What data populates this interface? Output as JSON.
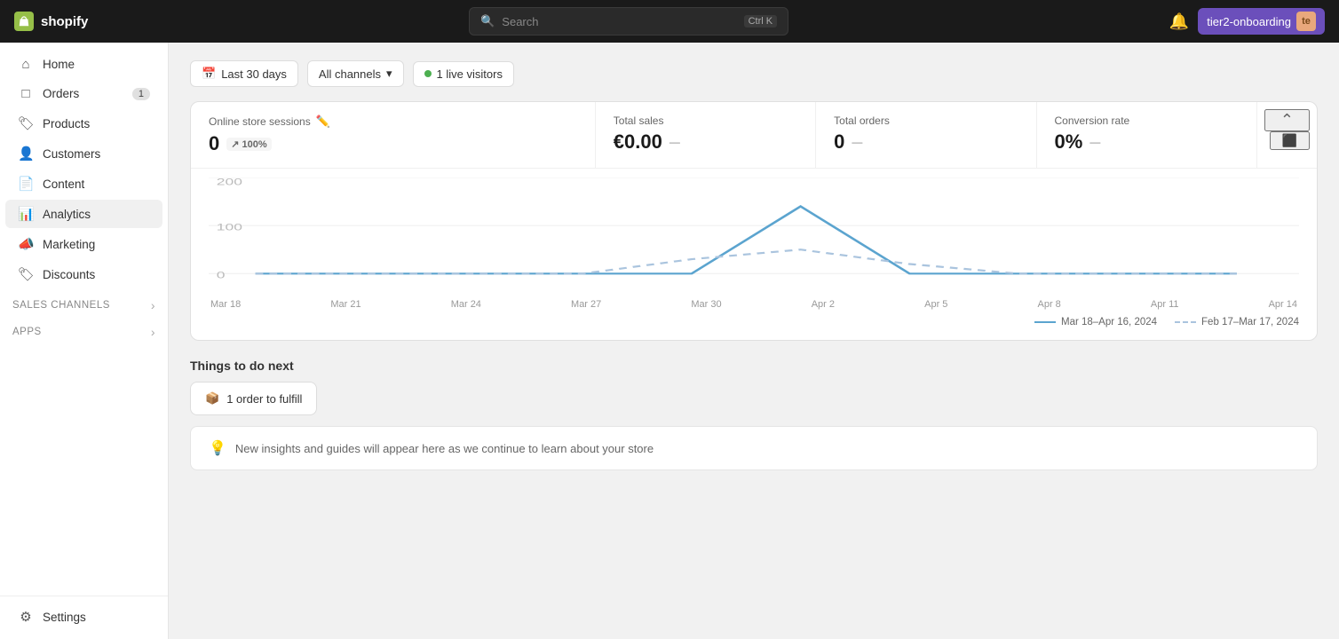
{
  "topbar": {
    "brand": "shopify",
    "search_placeholder": "Search",
    "search_shortcut": "Ctrl K",
    "bell_label": "Notifications",
    "user_name": "tier2-onboarding",
    "user_initials": "te"
  },
  "sidebar": {
    "items": [
      {
        "id": "home",
        "label": "Home",
        "icon": "🏠",
        "badge": null
      },
      {
        "id": "orders",
        "label": "Orders",
        "icon": "📦",
        "badge": "1"
      },
      {
        "id": "products",
        "label": "Products",
        "icon": "🏷",
        "badge": null
      },
      {
        "id": "customers",
        "label": "Customers",
        "icon": "👤",
        "badge": null
      },
      {
        "id": "content",
        "label": "Content",
        "icon": "📄",
        "badge": null
      },
      {
        "id": "analytics",
        "label": "Analytics",
        "icon": "📊",
        "badge": null
      },
      {
        "id": "marketing",
        "label": "Marketing",
        "icon": "📣",
        "badge": null
      },
      {
        "id": "discounts",
        "label": "Discounts",
        "icon": "🏷",
        "badge": null
      }
    ],
    "sections": [
      {
        "id": "sales-channels",
        "label": "Sales channels"
      },
      {
        "id": "apps",
        "label": "Apps"
      }
    ],
    "settings_label": "Settings"
  },
  "filters": {
    "date_range": "Last 30 days",
    "channels": "All channels",
    "live_visitors_dot": "green",
    "live_visitors_label": "1 live visitors"
  },
  "stats": {
    "online_sessions": {
      "label": "Online store sessions",
      "value": "0",
      "sub": "↗ 100%"
    },
    "total_sales": {
      "label": "Total sales",
      "value": "€0.00",
      "sub": "—"
    },
    "total_orders": {
      "label": "Total orders",
      "value": "0",
      "sub": "—"
    },
    "conversion_rate": {
      "label": "Conversion rate",
      "value": "0%",
      "sub": "—"
    }
  },
  "chart": {
    "y_labels": [
      "200",
      "100",
      "0"
    ],
    "x_labels": [
      "Mar 18",
      "Mar 21",
      "Mar 24",
      "Mar 27",
      "Mar 30",
      "Apr 2",
      "Apr 5",
      "Apr 8",
      "Apr 11",
      "Apr 14"
    ],
    "legend": [
      {
        "id": "current",
        "label": "Mar 18–Apr 16, 2024",
        "style": "solid"
      },
      {
        "id": "previous",
        "label": "Feb 17–Mar 17, 2024",
        "style": "dashed"
      }
    ]
  },
  "todo": {
    "section_title": "Things to do next",
    "order_btn": "1 order to fulfill",
    "insights_text": "New insights and guides will appear here as we continue to learn about your store"
  }
}
